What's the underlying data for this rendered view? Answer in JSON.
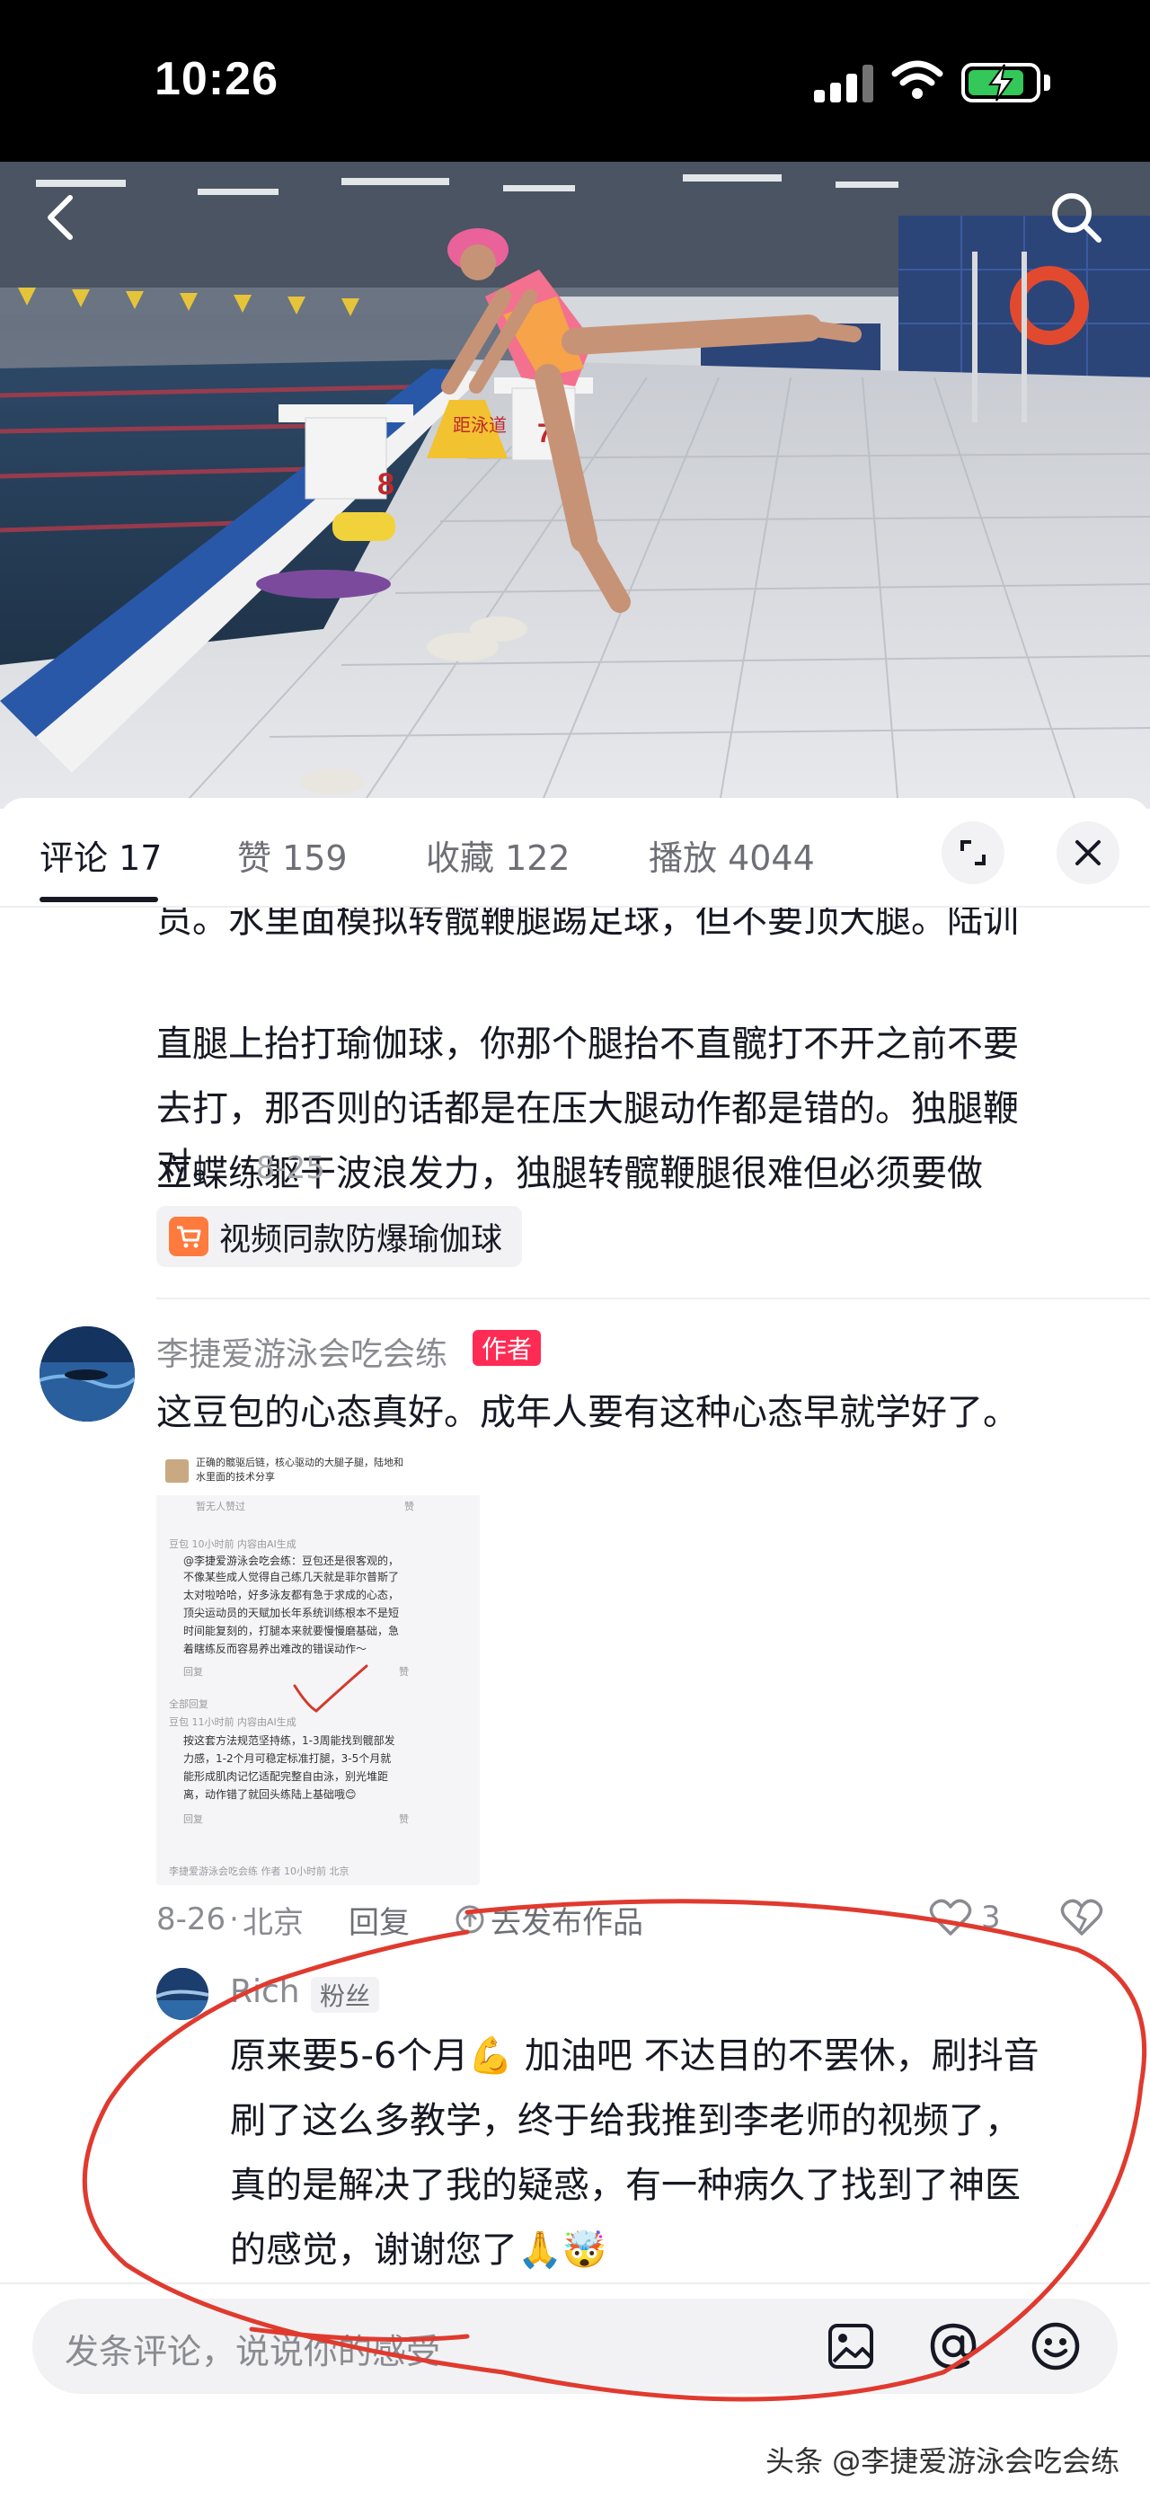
{
  "status_bar": {
    "time": "10:26",
    "battery_level": 0.85
  },
  "video": {
    "back_icon": "chevron-left-icon",
    "search_icon": "search-icon",
    "lane_sign": "距泳道",
    "block_numbers": [
      "8",
      "7"
    ]
  },
  "tabs": [
    {
      "label": "评论 17",
      "active": true
    },
    {
      "label": "赞 159",
      "active": false
    },
    {
      "label": "收藏 122",
      "active": false
    },
    {
      "label": "播放 4044",
      "active": false
    }
  ],
  "tab_icons": {
    "expand": "expand-icon",
    "close": "close-icon"
  },
  "prev_comment": {
    "lines": [
      "员。水里面模拟转髋鞭腿踢足球，但不要顶大腿。陆训",
      "直腿上抬打瑜伽球，你那个腿抬不直髋打不开之前不要",
      "去打，那否则的话都是在压大腿动作都是错的。独腿鞭",
      "立蝶练躯干波浪发力，独腿转髋鞭腿很难但必须要做"
    ],
    "last_line": "对。",
    "date": "8-25",
    "product_label": "视频同款防爆瑜伽球"
  },
  "author_comment": {
    "username": "李捷爱游泳会吃会练",
    "badge": "作者",
    "text": "这豆包的心态真好。成年人要有这种心态早就学好了。",
    "meta_date": "8-26",
    "meta_location": "北京",
    "reply_label": "回复",
    "publish_label": "去发布作品",
    "like_count": "3"
  },
  "screenshot": {
    "header_lines": [
      "正确的髋驱后链，核心驱动的大腿子腿，陆地和",
      "水里面的技术分享"
    ],
    "no_likes": "暂无人赞过",
    "like_word": "赞",
    "reply_word": "回复",
    "all_replies": "全部回复",
    "meta1": "豆包  10小时前  内容由AI生成",
    "reply1": [
      "@李捷爱游泳会吃会练：豆包还是很客观的，",
      "不像某些成人觉得自己练几天就是菲尔普斯了",
      "太对啦哈哈，好多泳友都有急于求成的心态，",
      "顶尖运动员的天赋加长年系统训练根本不是短",
      "时间能复刻的，打腿本来就要慢慢磨基础，急",
      "着瞎练反而容易养出难改的错误动作～"
    ],
    "meta2": "豆包  11小时前  内容由AI生成",
    "reply2": [
      "按这套方法规范坚持练，1-3周能找到髋部发",
      "力感，1-2个月可稳定标准打腿，3-5个月就",
      "能形成肌肉记忆适配完整自由泳，别光堆距",
      "离，动作错了就回头练陆上基础哦😊"
    ],
    "footer": "李捷爱游泳会吃会练  作者  10小时前  北京"
  },
  "fan_comment": {
    "username": "Rich",
    "badge": "粉丝",
    "lines": [
      "原来要5-6个月💪 加油吧 不达目的不罢休，刷抖音",
      "刷了这么多教学，终于给我推到李老师的视频了，",
      "真的是解决了我的疑惑，有一种病久了找到了神医",
      "的感觉，谢谢您了🙏🤯"
    ]
  },
  "input": {
    "placeholder": "发条评论，说说你的感受",
    "icons": [
      "image-icon",
      "at-icon",
      "emoji-icon"
    ]
  },
  "watermark": "头条 @李捷爱游泳会吃会练",
  "colors": {
    "accent": "#fe2c55",
    "annotation": "#e03a2f",
    "text": "#161823",
    "muted": "#8a8b91"
  }
}
